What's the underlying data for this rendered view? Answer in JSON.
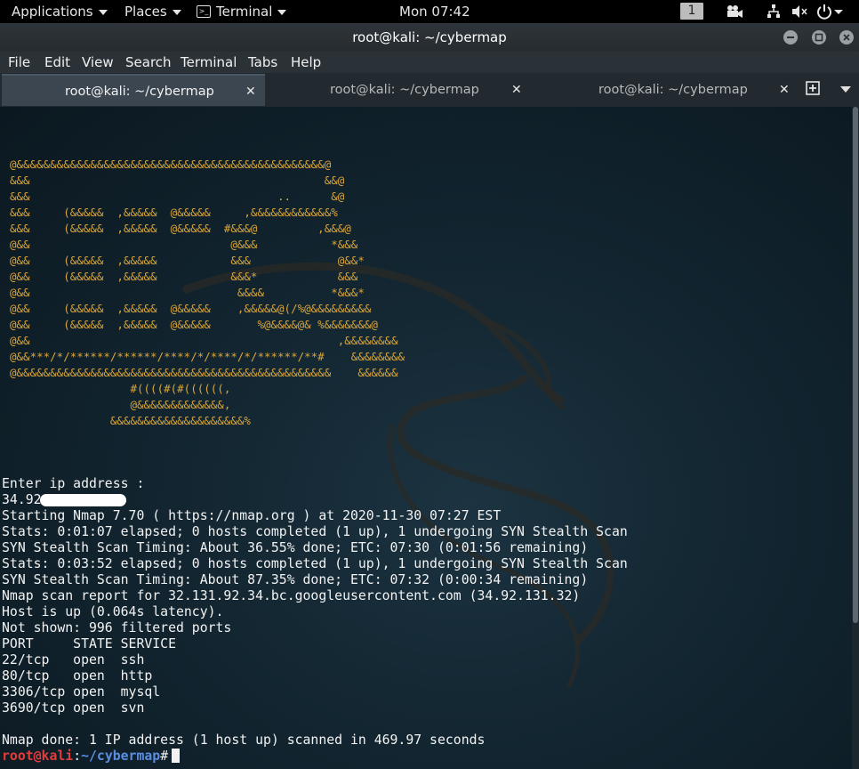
{
  "topbar": {
    "applications": "Applications",
    "places": "Places",
    "terminal": "Terminal",
    "clock": "Mon 07:42",
    "workspace": "1",
    "icons": [
      "video-camera-icon",
      "network-icon",
      "volume-icon",
      "power-icon"
    ]
  },
  "window": {
    "title": "root@kali: ~/cybermap",
    "controls": [
      "minimize-icon",
      "maximize-icon",
      "close-icon"
    ]
  },
  "menubar": [
    "File",
    "Edit",
    "View",
    "Search",
    "Terminal",
    "Tabs",
    "Help"
  ],
  "tabs": [
    {
      "label": "root@kali: ~/cybermap",
      "active": true
    },
    {
      "label": "root@kali: ~/cybermap",
      "active": false
    },
    {
      "label": "root@kali: ~/cybermap",
      "active": false
    }
  ],
  "terminal": {
    "ascii_banner": "@&&&&&&&&&&&&&&&&&&&&&&&&&&&&&&&&&&&&&&&&&&&&&&@\n&&&                                            &&@\n&&&                                     ..      &@\n&&&     (&&&&&  ,&&&&&  @&&&&&     ,&&&&&&&&&&&&%\n&&&     (&&&&&  ,&&&&&  @&&&&&  #&&&@         ,&&&@\n@&&                              @&&&           *&&&\n@&&     (&&&&&  ,&&&&&           &&&             @&&*\n@&&     (&&&&&  ,&&&&&           &&&*            &&&\n@&&                               &&&&          *&&&*\n@&&     (&&&&&  ,&&&&&  @&&&&&    ,&&&&&@(/%@&&&&&&&&&\n@&&     (&&&&&  ,&&&&&  @&&&&&       %@&&&&@& %&&&&&&&@\n@&&                                              ,&&&&&&&&\n@&&***/*/******/******/****/*/****/*/******/**#    &&&&&&&&\n@&&&&&&&&&&&&&&&&&&&&&&&&&&&&&&&&&&&&&&&&&&&&&&&    &&&&&&\n                  #((((#(#((((((,\n                  @&&&&&&&&&&&&&,\n               &&&&&&&&&&&&&&&&&&&&%",
    "output_lines": [
      "Enter ip address :",
      "34.92",
      "Starting Nmap 7.70 ( https://nmap.org ) at 2020-11-30 07:27 EST",
      "Stats: 0:01:07 elapsed; 0 hosts completed (1 up), 1 undergoing SYN Stealth Scan",
      "SYN Stealth Scan Timing: About 36.55% done; ETC: 07:30 (0:01:56 remaining)",
      "Stats: 0:03:52 elapsed; 0 hosts completed (1 up), 1 undergoing SYN Stealth Scan",
      "SYN Stealth Scan Timing: About 87.35% done; ETC: 07:32 (0:00:34 remaining)",
      "Nmap scan report for 32.131.92.34.bc.googleusercontent.com (34.92.131.32)",
      "Host is up (0.064s latency).",
      "Not shown: 996 filtered ports",
      "PORT     STATE SERVICE",
      "22/tcp   open  ssh",
      "80/tcp   open  http",
      "3306/tcp open  mysql",
      "3690/tcp open  svn",
      "",
      "Nmap done: 1 IP address (1 host up) scanned in 469.97 seconds"
    ],
    "prompt": {
      "user": "root@kali",
      "colon": ":",
      "path": "~/cybermap",
      "symbol": "#"
    }
  },
  "colors": {
    "prompt_user": "#e63b3b",
    "prompt_path": "#5a8de0",
    "banner": "#dba63a",
    "terminal_bg": "#122530"
  }
}
